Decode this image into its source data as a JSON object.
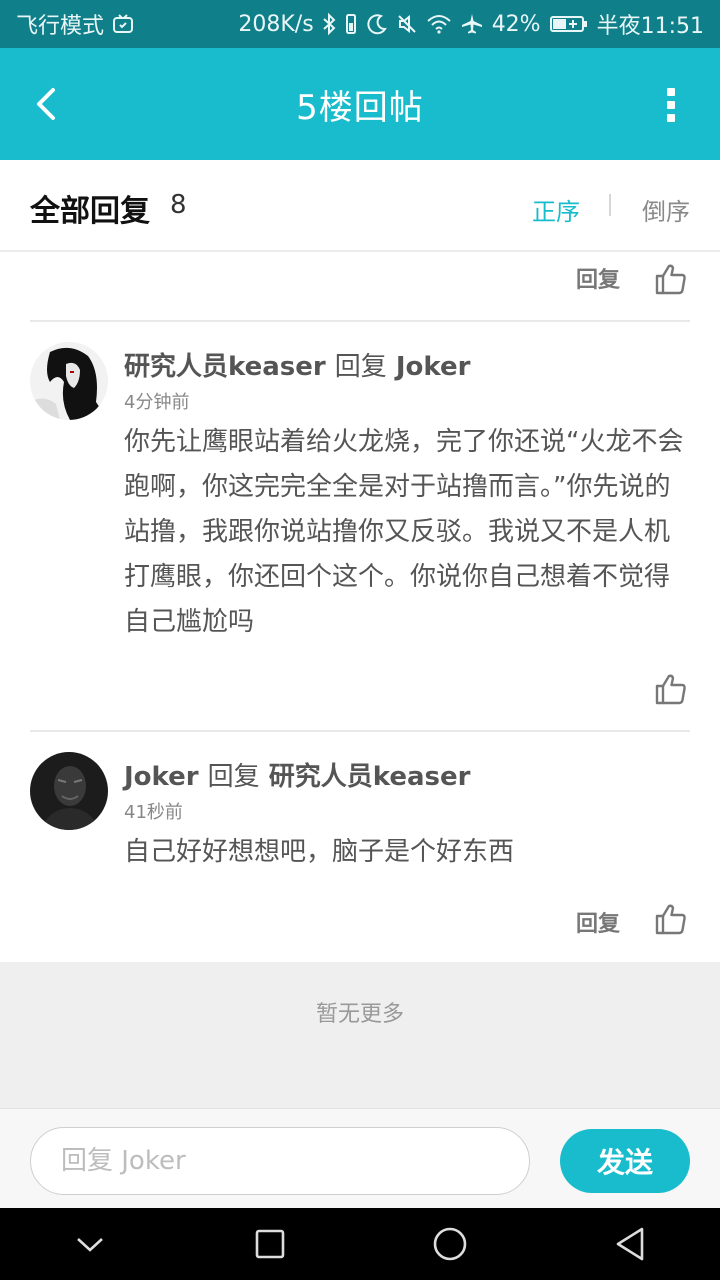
{
  "status_bar": {
    "airplane_mode": "飞行模式",
    "net_speed": "208K/s",
    "battery": "42%",
    "time": "半夜11:51"
  },
  "app_bar": {
    "title": "5楼回帖"
  },
  "replies_header": {
    "title": "全部回复",
    "count": "8",
    "sort_asc": "正序",
    "sort_desc": "倒序"
  },
  "top_actions": {
    "reply_label": "回复"
  },
  "comments": [
    {
      "author": "研究人员keaser",
      "reply_word": "回复",
      "target": "Joker",
      "time": "4分钟前",
      "body": "你先让鹰眼站着给火龙烧，完了你还说“火龙不会跑啊，你这完完全全是对于站撸而言。”你先说的站撸，我跟你说站撸你又反驳。我说又不是人机打鹰眼，你还回个这个。你说你自己想着不觉得自己尴尬吗"
    },
    {
      "author": "Joker",
      "reply_word": "回复",
      "target": "研究人员keaser",
      "time": "41秒前",
      "body": "自己好好想想吧，脑子是个好东西",
      "reply_label": "回复"
    }
  ],
  "footer": {
    "no_more": "暂无更多"
  },
  "input_bar": {
    "placeholder": "回复 Joker",
    "value": "",
    "send_label": "发送"
  },
  "colors": {
    "accent": "#18bccc",
    "status_bar": "#0f7f8a"
  }
}
